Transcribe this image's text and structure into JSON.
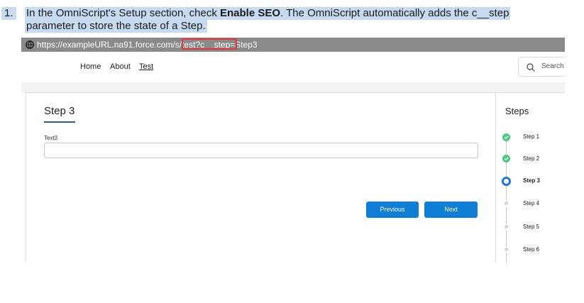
{
  "instruction": {
    "number": "1.",
    "line1_before": "In the OmniScript's Setup section, check ",
    "line1_bold": "Enable SEO",
    "line1_after": ". The OmniScript automatically adds the c__step",
    "line2": "parameter to store the state of a Step."
  },
  "browser": {
    "url_prefix": "https://exampleURL.na91.force.com/s/test?",
    "url_param": "c__step=Step3"
  },
  "nav": {
    "items": [
      "Home",
      "About",
      "Test"
    ],
    "active": "Test",
    "search_placeholder": "Search"
  },
  "form": {
    "step_title": "Step 3",
    "field_label": "Text3",
    "field_value": "",
    "previous_label": "Previous",
    "next_label": "Next"
  },
  "steps_panel": {
    "title": "Steps",
    "steps": [
      {
        "label": "Step 1",
        "status": "complete"
      },
      {
        "label": "Step 2",
        "status": "complete"
      },
      {
        "label": "Step 3",
        "status": "current"
      },
      {
        "label": "Step 4",
        "status": "upcoming"
      },
      {
        "label": "Step 5",
        "status": "upcoming"
      },
      {
        "label": "Step 6",
        "status": "upcoming"
      }
    ]
  },
  "colors": {
    "highlight": "#c6dbf0",
    "url_bar": "#8a8a8a",
    "url_param_box": "#e03a3a",
    "primary_button": "#0f7ed6",
    "step_complete": "#4bca81",
    "step_current": "#1c76d2"
  }
}
